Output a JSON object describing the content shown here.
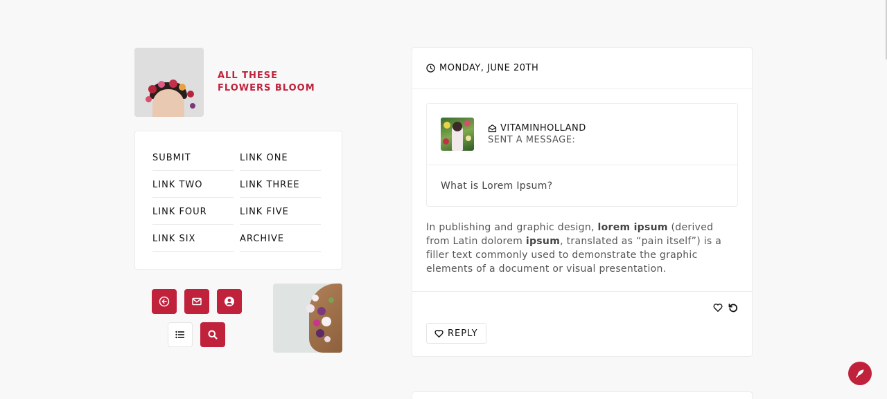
{
  "header": {
    "title": "ALL THESE FLOWERS BLOOM"
  },
  "nav": {
    "links": [
      {
        "label": "SUBMIT"
      },
      {
        "label": "LINK ONE"
      },
      {
        "label": "LINK TWO"
      },
      {
        "label": "LINK THREE"
      },
      {
        "label": "LINK FOUR"
      },
      {
        "label": "LINK FIVE"
      },
      {
        "label": "LINK SIX"
      },
      {
        "label": "ARCHIVE"
      }
    ]
  },
  "icon_buttons": [
    {
      "icon": "back-arrow-circle-icon"
    },
    {
      "icon": "envelope-icon"
    },
    {
      "icon": "user-circle-icon"
    },
    {
      "icon": "list-icon"
    },
    {
      "icon": "search-icon"
    }
  ],
  "post": {
    "date": "MONDAY, JUNE 20TH",
    "ask": {
      "asker": "VITAMINHOLLAND",
      "sent_label": "SENT A MESSAGE:",
      "question": "What is Lorem Ipsum?"
    },
    "answer": {
      "t1": "In publishing and graphic design, ",
      "b1": "lorem ipsum",
      "t2": " (derived from Latin dolorem ",
      "b2": "ipsum",
      "t3": ", translated as “pain itself”) is a filler text commonly used to demonstrate the graphic elements of a document or visual presentation."
    },
    "reply_label": "REPLY"
  },
  "colors": {
    "accent": "#c0213b",
    "background": "#f8f8f8",
    "card": "#ffffff",
    "border": "#ececec"
  }
}
